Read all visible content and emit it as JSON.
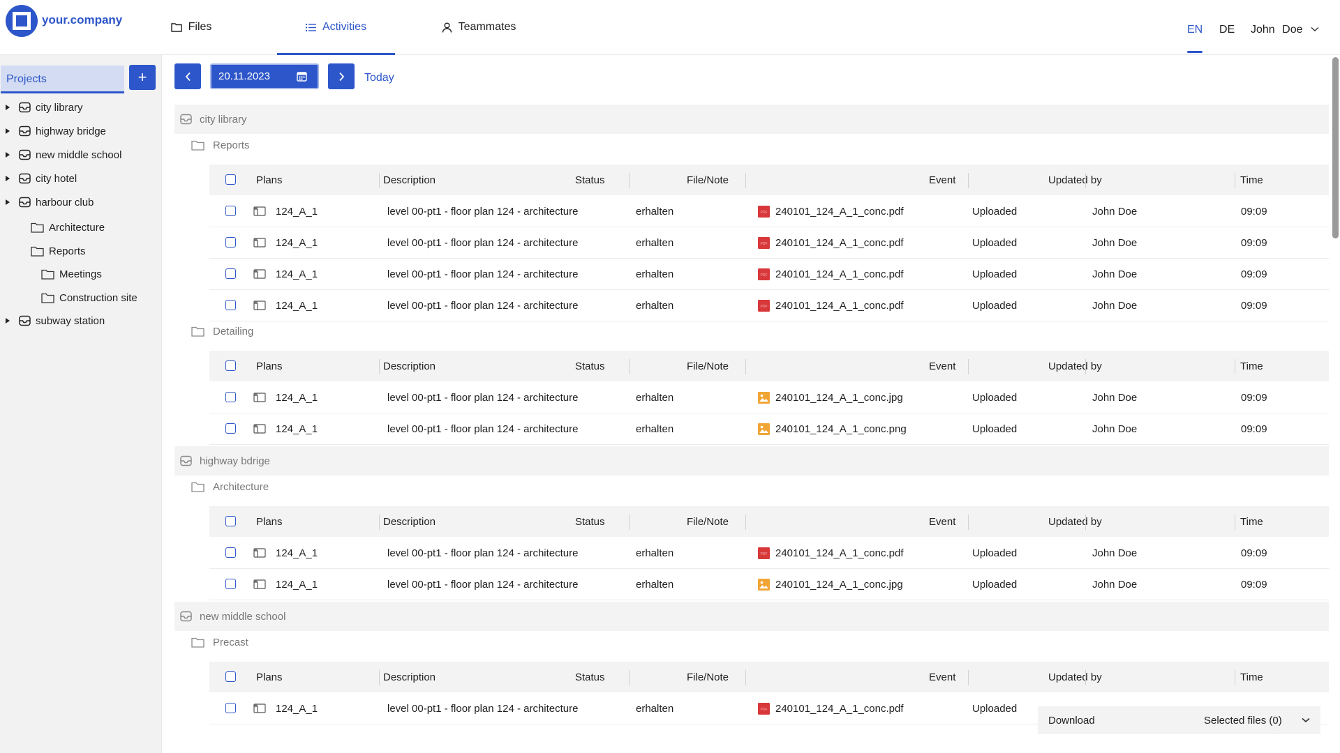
{
  "app": {
    "brand": "your.company"
  },
  "header": {
    "tabs": [
      {
        "label": "Files",
        "icon": "folder-icon",
        "active": false
      },
      {
        "label": "Activities",
        "icon": "list-icon",
        "active": true
      },
      {
        "label": "Teammates",
        "icon": "person-icon",
        "active": false
      }
    ],
    "languages": [
      {
        "label": "EN",
        "active": true
      },
      {
        "label": "DE",
        "active": false
      }
    ],
    "user": {
      "first": "John",
      "last": "Doe"
    }
  },
  "sidebar": {
    "tab_label": "Projects",
    "add_label": "+",
    "tree": [
      {
        "label": "city library",
        "level": 0,
        "expandable": true
      },
      {
        "label": "highway bridge",
        "level": 0,
        "expandable": true
      },
      {
        "label": "new middle school",
        "level": 0,
        "expandable": true
      },
      {
        "label": "city hotel",
        "level": 0,
        "expandable": true
      },
      {
        "label": "harbour club",
        "level": 0,
        "expandable": true
      },
      {
        "label": "Architecture",
        "level": 1,
        "expandable": false
      },
      {
        "label": "Reports",
        "level": 1,
        "expandable": false
      },
      {
        "label": "Meetings",
        "level": 2,
        "expandable": false
      },
      {
        "label": "Construction site",
        "level": 2,
        "expandable": false
      },
      {
        "label": "subway station",
        "level": 0,
        "expandable": true
      }
    ]
  },
  "toolbar": {
    "date": "20.11.2023",
    "today_label": "Today"
  },
  "columns": [
    "Plans",
    "Description",
    "Status",
    "File/Note",
    "Event",
    "Updated by",
    "Time"
  ],
  "colors": {
    "accent": "#2c56c9",
    "pdf": "#d8383a",
    "image": "#f0a534"
  },
  "groups": [
    {
      "project": "city library",
      "folders": [
        {
          "name": "Reports",
          "rows": [
            {
              "plan": "124_A_1",
              "description": "level 00-pt1 - floor plan 124 - architecture",
              "status": "erhalten",
              "file": "240101_124_A_1_conc.pdf",
              "type": "pdf",
              "event": "Uploaded",
              "updated_by": "John Doe",
              "time": "09:09"
            },
            {
              "plan": "124_A_1",
              "description": "level 00-pt1 - floor plan 124 - architecture",
              "status": "erhalten",
              "file": "240101_124_A_1_conc.pdf",
              "type": "pdf",
              "event": "Uploaded",
              "updated_by": "John Doe",
              "time": "09:09"
            },
            {
              "plan": "124_A_1",
              "description": "level 00-pt1 - floor plan 124 - architecture",
              "status": "erhalten",
              "file": "240101_124_A_1_conc.pdf",
              "type": "pdf",
              "event": "Uploaded",
              "updated_by": "John Doe",
              "time": "09:09"
            },
            {
              "plan": "124_A_1",
              "description": "level 00-pt1 - floor plan 124 - architecture",
              "status": "erhalten",
              "file": "240101_124_A_1_conc.pdf",
              "type": "pdf",
              "event": "Uploaded",
              "updated_by": "John Doe",
              "time": "09:09"
            }
          ]
        },
        {
          "name": "Detailing",
          "rows": [
            {
              "plan": "124_A_1",
              "description": "level 00-pt1 - floor plan 124 - architecture",
              "status": "erhalten",
              "file": "240101_124_A_1_conc.jpg",
              "type": "image",
              "event": "Uploaded",
              "updated_by": "John Doe",
              "time": "09:09"
            },
            {
              "plan": "124_A_1",
              "description": "level 00-pt1 - floor plan 124 - architecture",
              "status": "erhalten",
              "file": "240101_124_A_1_conc.png",
              "type": "image",
              "event": "Uploaded",
              "updated_by": "John Doe",
              "time": "09:09"
            }
          ]
        }
      ]
    },
    {
      "project": "highway bdrige",
      "folders": [
        {
          "name": "Architecture",
          "rows": [
            {
              "plan": "124_A_1",
              "description": "level 00-pt1 - floor plan 124 - architecture",
              "status": "erhalten",
              "file": "240101_124_A_1_conc.pdf",
              "type": "pdf",
              "event": "Uploaded",
              "updated_by": "John Doe",
              "time": "09:09"
            },
            {
              "plan": "124_A_1",
              "description": "level 00-pt1 - floor plan 124 - architecture",
              "status": "erhalten",
              "file": "240101_124_A_1_conc.jpg",
              "type": "image",
              "event": "Uploaded",
              "updated_by": "John Doe",
              "time": "09:09"
            }
          ]
        }
      ]
    },
    {
      "project": "new middle school",
      "folders": [
        {
          "name": "Precast",
          "rows": [
            {
              "plan": "124_A_1",
              "description": "level 00-pt1 - floor plan 124 - architecture",
              "status": "erhalten",
              "file": "240101_124_A_1_conc.pdf",
              "type": "pdf",
              "event": "Uploaded",
              "updated_by": "",
              "time": ""
            }
          ]
        }
      ]
    }
  ],
  "download_bar": {
    "label": "Download",
    "selected": "Selected files (0)"
  }
}
